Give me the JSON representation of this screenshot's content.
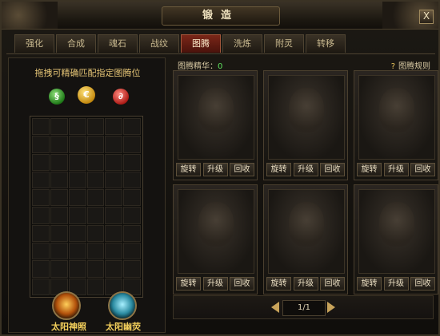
{
  "window": {
    "title": "锻造",
    "close_label": "X"
  },
  "tabs": [
    {
      "label": "强化",
      "active": false
    },
    {
      "label": "合成",
      "active": false
    },
    {
      "label": "魂石",
      "active": false
    },
    {
      "label": "战纹",
      "active": false
    },
    {
      "label": "图腾",
      "active": true
    },
    {
      "label": "洗炼",
      "active": false
    },
    {
      "label": "附灵",
      "active": false
    },
    {
      "label": "转移",
      "active": false
    }
  ],
  "left_panel": {
    "hint": "拖拽可精确匹配指定图腾位",
    "gems": [
      {
        "icon": "green-gem-icon",
        "glyph": "§"
      },
      {
        "icon": "yellow-gem-icon",
        "glyph": "€"
      },
      {
        "icon": "red-gem-icon",
        "glyph": "∂"
      }
    ],
    "grid": {
      "columns": 6,
      "rows": 10
    },
    "bottom_items": [
      {
        "label": "太阳神照",
        "icon": "sun-orb-icon"
      },
      {
        "label": "太阳幽荧",
        "icon": "moon-orb-icon"
      }
    ]
  },
  "right_panel": {
    "essence_label": "图腾精华：",
    "essence_value": "0",
    "rules_label": "图腾规则",
    "slot_buttons": [
      "旋转",
      "升级",
      "回收"
    ],
    "slot_count": 6
  },
  "pager": {
    "text": "1/1"
  },
  "colors": {
    "accent_tab": "#7a2618",
    "gold_text": "#f3cf5b",
    "green_value": "#5ee05e"
  }
}
